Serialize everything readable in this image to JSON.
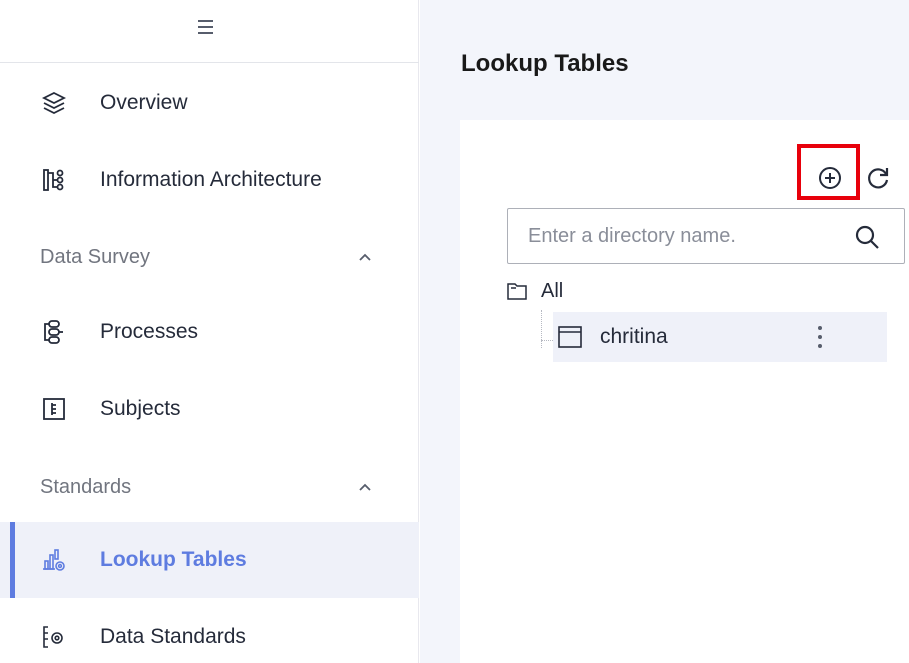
{
  "sidebar": {
    "items": [
      {
        "label": "Overview",
        "icon": "layers-icon"
      },
      {
        "label": "Information Architecture",
        "icon": "hierarchy-icon"
      },
      {
        "label": "Processes",
        "icon": "process-icon"
      },
      {
        "label": "Subjects",
        "icon": "subjects-icon"
      },
      {
        "label": "Lookup Tables",
        "icon": "lookup-table-icon",
        "active": true
      },
      {
        "label": "Data Standards",
        "icon": "data-standards-icon"
      }
    ],
    "groups": [
      {
        "label": "Data Survey"
      },
      {
        "label": "Standards"
      }
    ]
  },
  "main": {
    "title": "Lookup Tables",
    "search": {
      "placeholder": "Enter a directory name.",
      "value": ""
    },
    "tree": {
      "root": {
        "label": "All"
      },
      "children": [
        {
          "label": "chritina",
          "selected": true
        }
      ]
    }
  },
  "colors": {
    "accent": "#5e7ce0",
    "highlight": "#e8000b",
    "active_bg": "#eff1f9",
    "main_bg": "#f3f5fb"
  }
}
